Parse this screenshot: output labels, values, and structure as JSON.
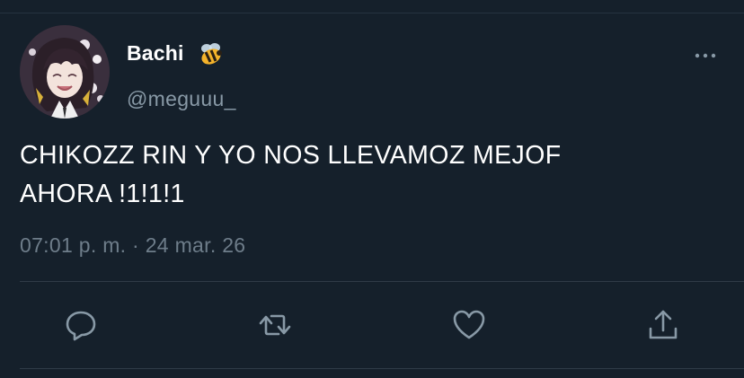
{
  "tweet": {
    "display_name": "Bachi",
    "handle": "@meguuu_",
    "text": "CHIKOZZ RIN Y YO NOS LLEVAMOZ MEJOF\nAHORA !1!1!1",
    "timestamp": "07:01 p. m. · 24 mar. 26"
  },
  "icons": {
    "name_emoji": "bee-icon",
    "more": "more-options-icon",
    "reply": "reply-icon",
    "retweet": "retweet-icon",
    "like": "like-icon",
    "share": "share-icon"
  },
  "colors": {
    "background": "#15202b",
    "text_primary": "#ffffff",
    "text_secondary": "#8899a6",
    "icon": "#8899a6",
    "divider": "#2f3b47"
  }
}
